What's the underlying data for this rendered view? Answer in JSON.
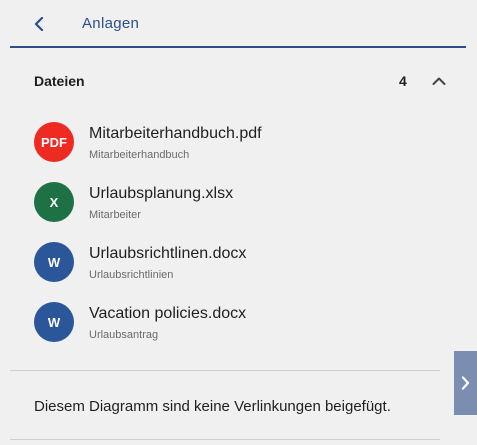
{
  "header": {
    "title": "Anlagen",
    "back_icon": "chevron-left-icon",
    "accent_color": "#2c4f86"
  },
  "section": {
    "title": "Dateien",
    "count": "4",
    "collapse_icon": "chevron-up-icon"
  },
  "files": [
    {
      "name": "Mitarbeiterhandbuch.pdf",
      "subtitle": "Mitarbeiterhandbuch",
      "icon_label": "PDF",
      "icon_color": "#ee2b22"
    },
    {
      "name": "Urlaubsplanung.xlsx",
      "subtitle": "Mitarbeiter",
      "icon_label": "X",
      "icon_color": "#1e7145"
    },
    {
      "name": "Urlaubsrichtlinen.docx",
      "subtitle": "Urlaubsrichtlinien",
      "icon_label": "W",
      "icon_color": "#2b579a"
    },
    {
      "name": "Vacation policies.docx",
      "subtitle": "Urlaubsantrag",
      "icon_label": "W",
      "icon_color": "#2b579a"
    }
  ],
  "no_links_text": "Diesem Diagramm sind keine Verlinkungen beigefügt.",
  "expand_tab": {
    "icon": "chevron-right-icon",
    "color": "#7b8db0"
  }
}
